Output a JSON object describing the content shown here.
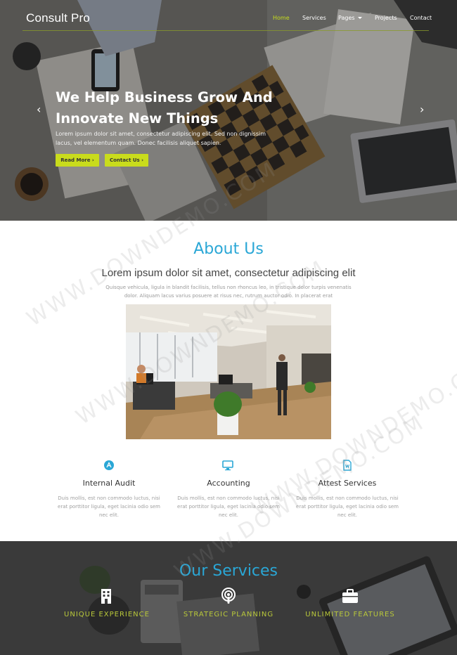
{
  "nav": {
    "brand": "Consult Pro",
    "items": [
      {
        "label": "Home"
      },
      {
        "label": "Services"
      },
      {
        "label": "Pages"
      },
      {
        "label": "Projects"
      },
      {
        "label": "Contact"
      }
    ]
  },
  "hero": {
    "title_line1": "We Help Business Grow And",
    "title_line2": "Innovate New Things",
    "text": "Lorem ipsum dolor sit amet, consectetur adipiscing elit. Sed non dignissim lacus, vel elementum quam. Donec facilisis aliquet sapien.",
    "read_more": "Read More",
    "contact_us": "Contact Us",
    "prev_arrow": "‹",
    "next_arrow": "›"
  },
  "about": {
    "title": "About Us",
    "subtitle": "Lorem ipsum dolor sit amet, consectetur adipiscing elit",
    "text": "Quisque vehicula, ligula in blandit facilisis, tellus non rhoncus leo, in tristique dolor turpis venenatis dolor. Aliquam lacus varius posuere at risus nec, rutrum auctor odio. In placerat erat"
  },
  "features": [
    {
      "icon": "a-circle-icon",
      "title": "Internal Audit",
      "text": "Duis mollis, est non commodo luctus, nisi erat porttitor ligula, eget lacinia odio sem nec elit."
    },
    {
      "icon": "monitor-icon",
      "title": "Accounting",
      "text": "Duis mollis, est non commodo luctus, nisi erat porttitor ligula, eget lacinia odio sem nec elit."
    },
    {
      "icon": "document-icon",
      "title": "Attest Services",
      "text": "Duis mollis, est non commodo luctus, nisi erat porttitor ligula, eget lacinia odio sem nec elit."
    }
  ],
  "services": {
    "title": "Our Services",
    "items": [
      {
        "icon": "building-icon",
        "label": "UNIQUE EXPERIENCE"
      },
      {
        "icon": "podcast-icon",
        "label": "STRATEGIC PLANNING"
      },
      {
        "icon": "briefcase-icon",
        "label": "UNLIMITED FEATURES"
      }
    ]
  },
  "watermark": "WWW.DOWNDEMO.COM",
  "colors": {
    "accent": "#c9dc1c",
    "heading_blue": "#2aa7d6",
    "service_label": "#b9c83a"
  }
}
